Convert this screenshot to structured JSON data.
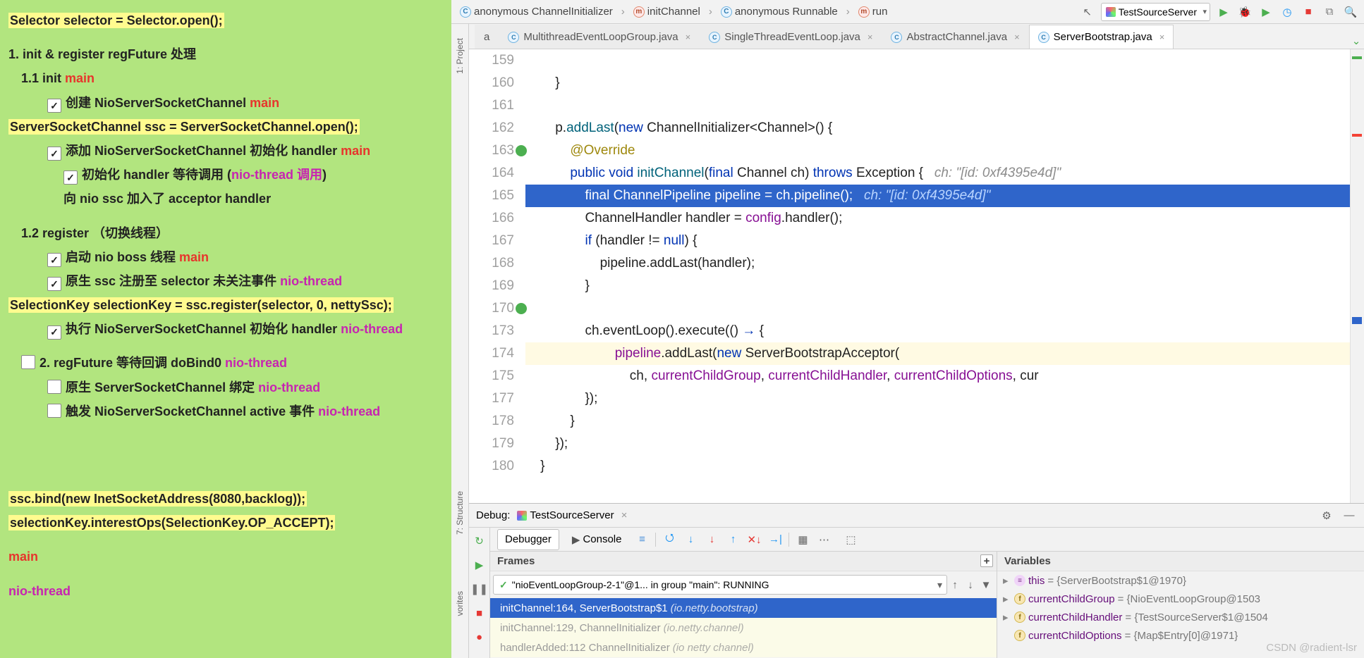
{
  "notes": {
    "l1": "Selector selector = Selector.open();",
    "l2": "1. init & register regFuture 处理",
    "l3_a": "1.1 init ",
    "l3_b": "main",
    "l4_a": "创建 NioServerSocketChannel   ",
    "l4_b": "main",
    "l5": "ServerSocketChannel ssc = ServerSocketChannel.open();",
    "l6_a": "添加 NioServerSocketChannel 初始化 handler ",
    "l6_b": "main",
    "l7_a": "初始化 handler 等待调用   (",
    "l7_b": "nio-thread 调用",
    "l7_c": ")",
    "l8": "向 nio ssc 加入了 acceptor handler",
    "l9": "1.2 register  （切换线程）",
    "l10_a": "启动 nio boss 线程  ",
    "l10_b": "main",
    "l11_a": "原生 ssc 注册至 selector 未关注事件 ",
    "l11_b": "nio-thread",
    "l12": "SelectionKey selectionKey = ssc.register(selector, 0, nettySsc);",
    "l13_a": "执行 NioServerSocketChannel 初始化 handler ",
    "l13_b": "nio-thread",
    "l14_a": "2. regFuture 等待回调 doBind0 ",
    "l14_b": "nio-thread",
    "l15_a": "原生 ServerSocketChannel 绑定 ",
    "l15_b": "nio-thread",
    "l16_a": "触发 NioServerSocketChannel active 事件 ",
    "l16_b": "nio-thread",
    "l17": "ssc.bind(new InetSocketAddress(8080,backlog));",
    "l18": "selectionKey.interestOps(SelectionKey.OP_ACCEPT);",
    "l19": "main",
    "l20": "nio-thread"
  },
  "crumbs": {
    "c1": "anonymous ChannelInitializer",
    "c2": "initChannel",
    "c3": "anonymous Runnable",
    "c4": "run"
  },
  "runConfig": "TestSourceServer",
  "sideTabs": {
    "project": "1: Project",
    "structure": "7: Structure",
    "favorites": "vorites"
  },
  "tabs": {
    "t0": "a",
    "t1": "MultithreadEventLoopGroup.java",
    "t2": "SingleThreadEventLoop.java",
    "t3": "AbstractChannel.java",
    "t4": "ServerBootstrap.java"
  },
  "gutter": [
    "159",
    "160",
    "161",
    "162",
    "163",
    "164",
    "165",
    "166",
    "167",
    "168",
    "169",
    "170",
    "173",
    "174",
    "175",
    "177",
    "178",
    "179",
    "180"
  ],
  "code": {
    "l159": "        }",
    "l160": "",
    "l161_a": "        p.",
    "l161_b": "addLast",
    "l161_c": "(",
    "l161_d": "new",
    "l161_e": " ChannelInitializer<Channel>() {",
    "l162": "            ",
    "l162_b": "@Override",
    "l163_a": "            ",
    "l163_b": "public void ",
    "l163_c": "initChannel",
    "l163_d": "(",
    "l163_e": "final",
    "l163_f": " Channel ch) ",
    "l163_g": "throws",
    "l163_h": " Exception {   ",
    "l163_i": "ch: \"[id: 0xf4395e4d]\"",
    "l164_a": "                ",
    "l164_b": "final",
    "l164_c": " ChannelPipeline pipeline = ch.pipeline();   ",
    "l164_d": "ch: \"[id: 0xf4395e4d]\"",
    "l165_a": "                ChannelHandler handler = ",
    "l165_b": "config",
    "l165_c": ".handler();",
    "l166_a": "                ",
    "l166_b": "if",
    "l166_c": " (handler != ",
    "l166_d": "null",
    "l166_e": ") {",
    "l167": "                    pipeline.addLast(handler);",
    "l168": "                }",
    "l169": "",
    "l170_a": "                ch.eventLoop().execute(() ",
    "l170_b": "→",
    "l170_c": " {",
    "l173_a": "                        ",
    "l173_b": "pipeline",
    "l173_c": ".addLast(",
    "l173_d": "new",
    "l173_e": " ServerBootstrapAcceptor(",
    "l174_a": "                            ch, ",
    "l174_b": "currentChildGroup",
    "l174_c": ", ",
    "l174_d": "currentChildHandler",
    "l174_e": ", ",
    "l174_f": "currentChildOptions",
    "l174_g": ", cur",
    "l175": "                });",
    "l177": "            }",
    "l178": "        });",
    "l179": "    }",
    "l180": ""
  },
  "debug": {
    "title": "Debug:",
    "config": "TestSourceServer",
    "tabDebugger": "Debugger",
    "tabConsole": "Console",
    "framesTitle": "Frames",
    "varsTitle": "Variables",
    "thread": "\"nioEventLoopGroup-2-1\"@1... in group \"main\": RUNNING",
    "f1a": "initChannel:164, ServerBootstrap$1 ",
    "f1b": "(io.netty.bootstrap)",
    "f2a": "initChannel:129, ChannelInitializer ",
    "f2b": "(io.netty.channel)",
    "f3a": "handlerAdded:112  ChannelInitializer ",
    "f3b": "(io netty channel)",
    "v1n": "this",
    "v1v": " = {ServerBootstrap$1@1970}",
    "v2n": "currentChildGroup",
    "v2v": " = {NioEventLoopGroup@1503",
    "v3n": "currentChildHandler",
    "v3v": " = {TestSourceServer$1@1504",
    "v4n": "currentChildOptions",
    "v4v": " = {Map$Entry[0]@1971}"
  },
  "watermark": "CSDN @radient-lsr"
}
